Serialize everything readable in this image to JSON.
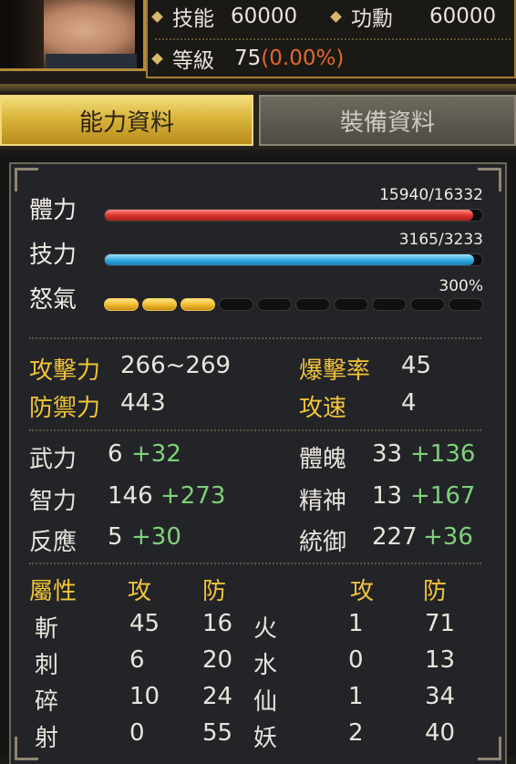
{
  "header": {
    "skill_label": "技能",
    "skill_value": "60000",
    "merit_label": "功勳",
    "merit_value": "60000",
    "level_label": "等級",
    "level_value": "75",
    "level_pct": "(0.00%)"
  },
  "tabs": [
    {
      "label": "能力資料",
      "active": true
    },
    {
      "label": "裝備資料",
      "active": false
    }
  ],
  "bars": {
    "hp": {
      "label": "體力",
      "value": "15940/16332",
      "fraction": 0.976
    },
    "sp": {
      "label": "技力",
      "value": "3165/3233",
      "fraction": 0.979
    },
    "rage": {
      "label": "怒氣",
      "value": "300%",
      "filled_segments": 3,
      "total_segments": 10
    }
  },
  "combat": {
    "attack_label": "攻擊力",
    "attack_value": "266~269",
    "crit_label": "爆擊率",
    "crit_value": "45",
    "defense_label": "防禦力",
    "defense_value": "443",
    "speed_label": "攻速",
    "speed_value": "4"
  },
  "attributes": [
    {
      "label": "武力",
      "base": "6",
      "bonus": "+32"
    },
    {
      "label": "智力",
      "base": "146",
      "bonus": "+273"
    },
    {
      "label": "反應",
      "base": "5",
      "bonus": "+30"
    },
    {
      "label": "體魄",
      "base": "33",
      "bonus": "+136"
    },
    {
      "label": "精神",
      "base": "13",
      "bonus": "+167"
    },
    {
      "label": "統御",
      "base": "227",
      "bonus": "+36"
    }
  ],
  "elements": {
    "header_label": "屬性",
    "atk_header": "攻",
    "def_header": "防",
    "atk_header_2": "攻",
    "def_header_2": "防",
    "left": [
      {
        "name": "斬",
        "atk": "45",
        "def": "16"
      },
      {
        "name": "刺",
        "atk": "6",
        "def": "20"
      },
      {
        "name": "碎",
        "atk": "10",
        "def": "24"
      },
      {
        "name": "射",
        "atk": "0",
        "def": "55"
      }
    ],
    "right": [
      {
        "name": "火",
        "atk": "1",
        "def": "71"
      },
      {
        "name": "水",
        "atk": "0",
        "def": "13"
      },
      {
        "name": "仙",
        "atk": "1",
        "def": "34"
      },
      {
        "name": "妖",
        "atk": "2",
        "def": "40"
      }
    ]
  },
  "colors": {
    "gold_text": "#f0c43a",
    "bonus_green": "#7fd17a",
    "level_pct": "#e06a2a",
    "hp_bar": "#d9302b",
    "sp_bar": "#2fa6e0",
    "rage_bar": "#f0b92a"
  }
}
